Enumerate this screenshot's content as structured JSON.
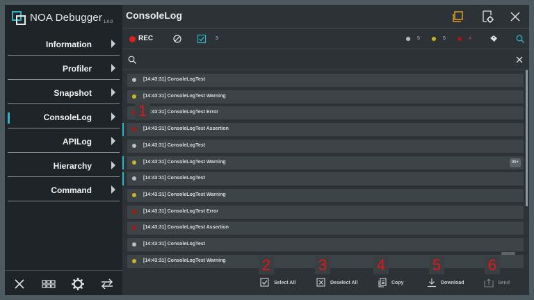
{
  "app": {
    "name": "NOA Debugger",
    "version": "1.0.0"
  },
  "sidebar": {
    "items": [
      {
        "label": "Information"
      },
      {
        "label": "Profiler"
      },
      {
        "label": "Snapshot"
      },
      {
        "label": "ConsoleLog"
      },
      {
        "label": "APILog"
      },
      {
        "label": "Hierarchy"
      },
      {
        "label": "Command"
      }
    ],
    "footer_icons": [
      "close-icon",
      "grid-icon",
      "gear-icon",
      "swap-icon"
    ]
  },
  "header": {
    "title": "ConsoleLog",
    "icons": [
      "window-icon",
      "window-settings-icon",
      "close-icon"
    ]
  },
  "toolbar": {
    "rec_label": "REC",
    "collapse_count": "3",
    "log_count": "5",
    "warning_count": "5",
    "error_count": "4"
  },
  "search": {
    "placeholder": ""
  },
  "logs": [
    {
      "level": "log",
      "text": "[14:43:31] ConsoleLogTest"
    },
    {
      "level": "warning",
      "text": "[14:43:31] ConsoleLogTest Warning"
    },
    {
      "level": "error",
      "text": "[14:43:31] ConsoleLogTest Error"
    },
    {
      "level": "error",
      "text": "[14:43:31] ConsoleLogTest Assertion"
    },
    {
      "level": "log",
      "text": "[14:43:31] ConsoleLogTest"
    },
    {
      "level": "warning",
      "text": "[14:43:31] ConsoleLogTest Warning",
      "badge": "99+"
    },
    {
      "level": "log",
      "text": "[14:43:31] ConsoleLogTest"
    },
    {
      "level": "warning",
      "text": "[14:43:31] ConsoleLogTest Warning"
    },
    {
      "level": "error",
      "text": "[14:43:31] ConsoleLogTest Error"
    },
    {
      "level": "error",
      "text": "[14:43:31] ConsoleLogTest Assertion"
    },
    {
      "level": "log",
      "text": "[14:43:31] ConsoleLogTest"
    },
    {
      "level": "warning",
      "text": "[14:43:31] ConsoleLogTest Warning"
    }
  ],
  "actions": {
    "select_all": "Select All",
    "deselect_all": "Deselect All",
    "copy": "Copy",
    "download": "Download",
    "send": "Send"
  },
  "annotations": [
    "1",
    "2",
    "3",
    "4",
    "5",
    "6"
  ],
  "colors": {
    "accent": "#2db5c8",
    "rec": "#e02020",
    "log_dot": "#b8bec1",
    "warning_dot": "#c9b627",
    "error_dot": "#a81818",
    "annotation": "#e8141c",
    "window_icon": "#e0a020"
  }
}
